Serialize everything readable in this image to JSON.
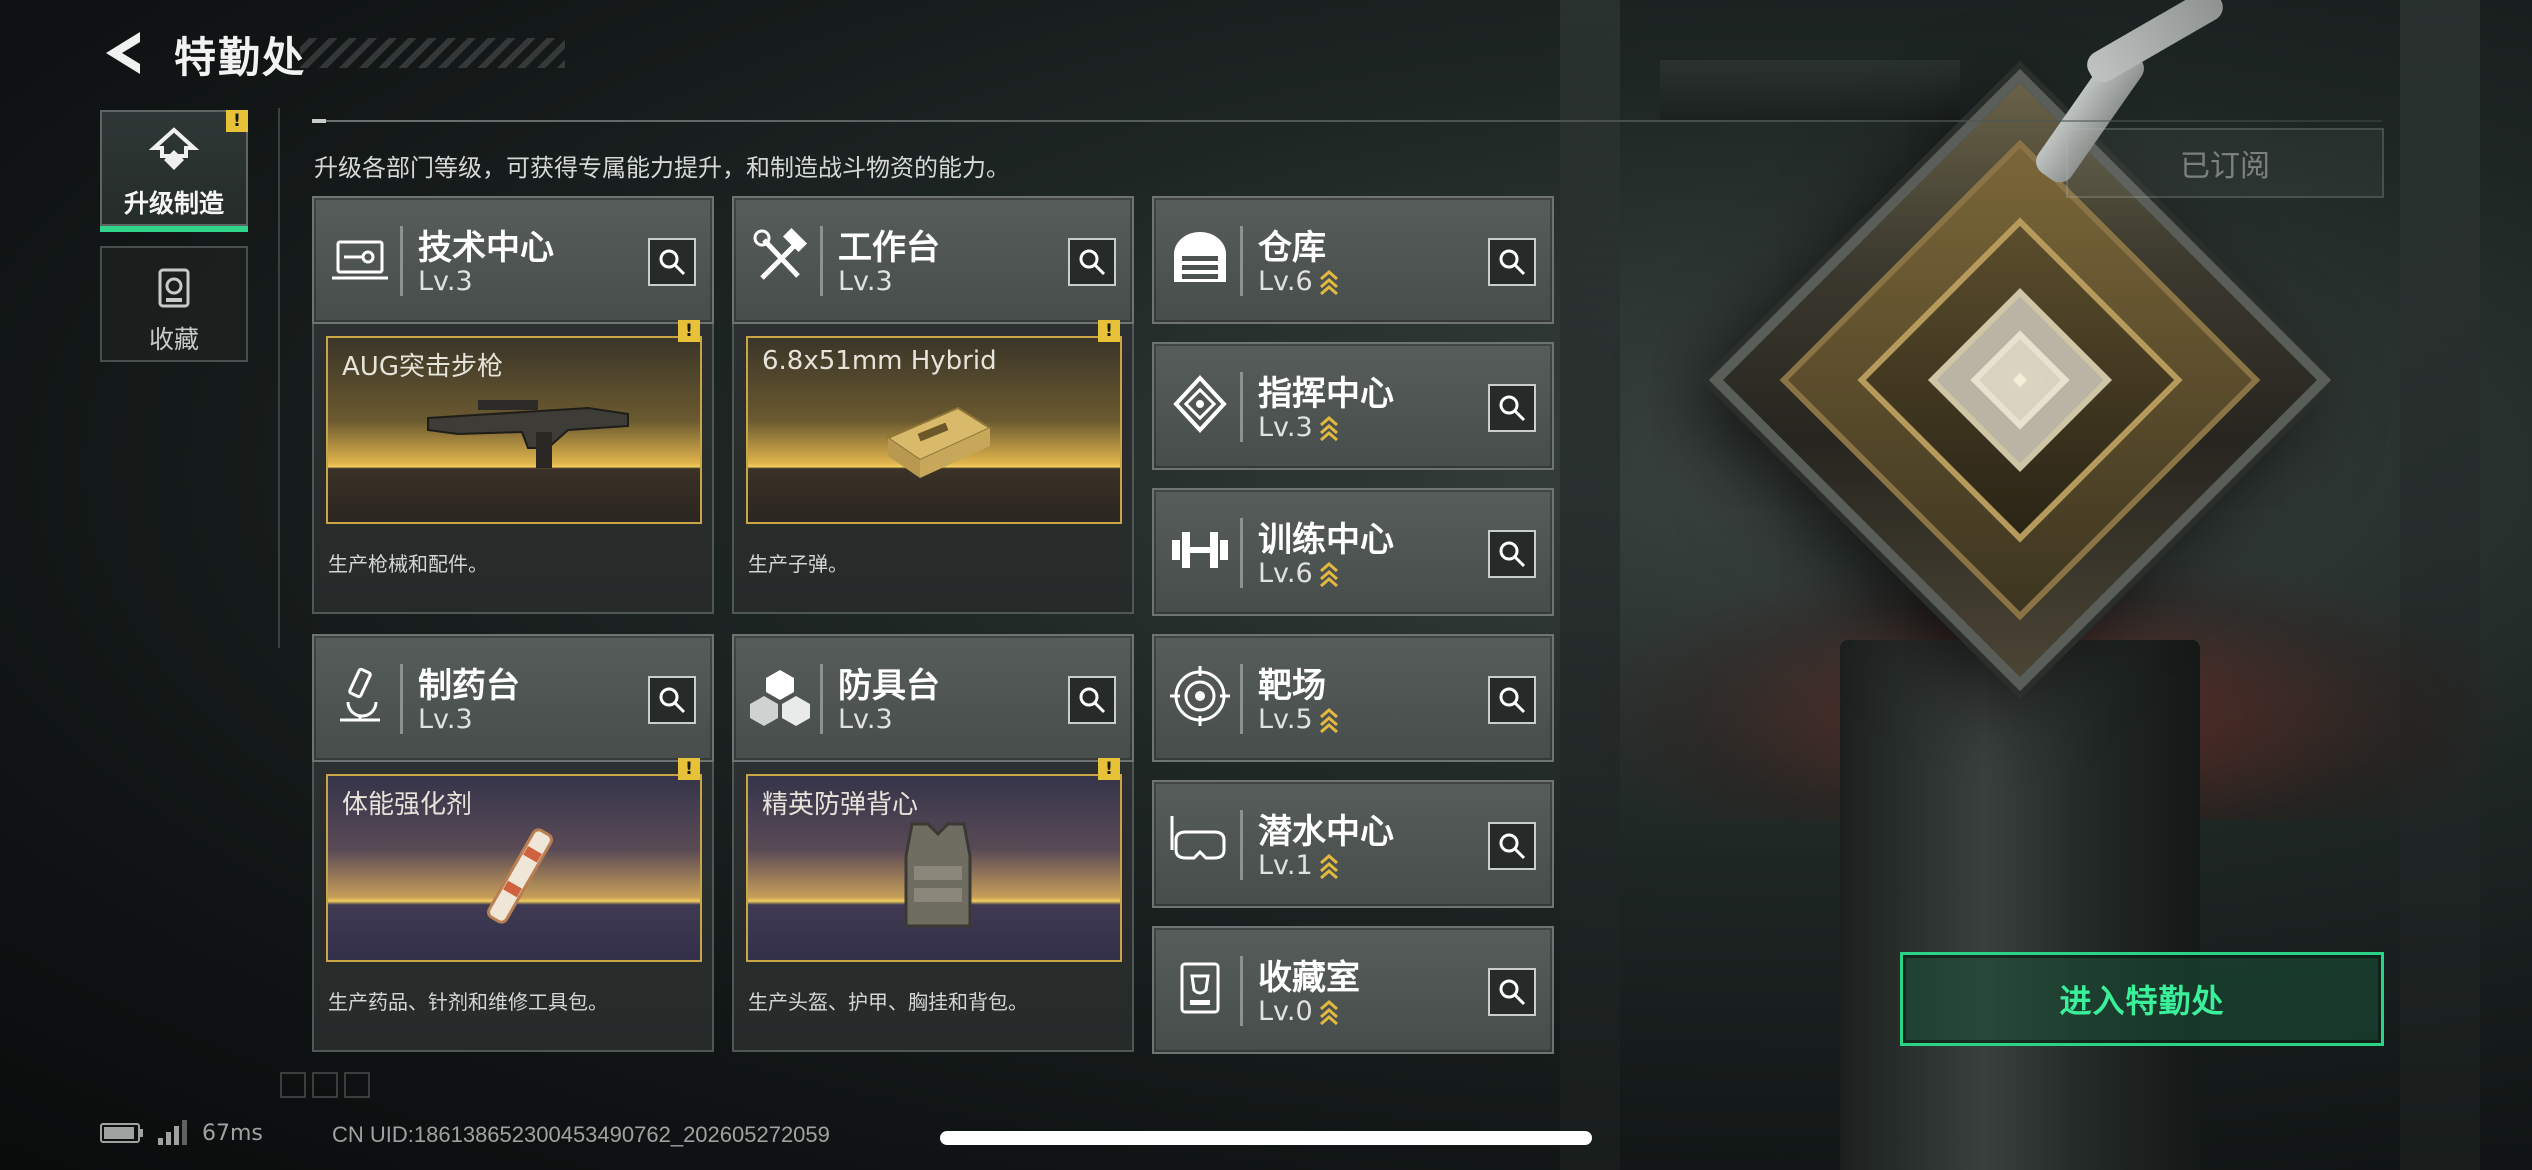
{
  "header": {
    "title": "特勤处"
  },
  "nav": [
    {
      "label": "升级制造",
      "icon": "upgrade-icon",
      "active": true
    },
    {
      "label": "收藏",
      "icon": "collection-icon",
      "active": false
    }
  ],
  "description": "升级各部门等级，可获得专属能力提升，和制造战斗物资的能力。",
  "subscribed_label": "已订阅",
  "enter_label": "进入特勤处",
  "departments": {
    "tech": {
      "name": "技术中心",
      "level": "Lv.3",
      "icon": "tech-center-icon"
    },
    "workbench": {
      "name": "工作台",
      "level": "Lv.3",
      "icon": "hammer-wrench-icon"
    },
    "pharmacy": {
      "name": "制药台",
      "level": "Lv.3",
      "icon": "microscope-icon"
    },
    "armor": {
      "name": "防具台",
      "level": "Lv.3",
      "icon": "cubes-icon"
    },
    "warehouse": {
      "name": "仓库",
      "level": "Lv.6",
      "icon": "warehouse-icon"
    },
    "command": {
      "name": "指挥中心",
      "level": "Lv.3",
      "icon": "chip-icon"
    },
    "training": {
      "name": "训练中心",
      "level": "Lv.6",
      "icon": "dumbbell-icon"
    },
    "range": {
      "name": "靶场",
      "level": "Lv.5",
      "icon": "target-icon"
    },
    "diving": {
      "name": "潜水中心",
      "level": "Lv.1",
      "icon": "diving-mask-icon"
    },
    "collection": {
      "name": "收藏室",
      "level": "Lv.0",
      "icon": "trophy-icon"
    }
  },
  "production": {
    "tech": {
      "item": "AUG突击步枪",
      "desc": "生产枪械和配件。"
    },
    "workbench": {
      "item": "6.8x51mm Hybrid",
      "desc": "生产子弹。"
    },
    "pharmacy": {
      "item": "体能强化剂",
      "desc": "生产药品、针剂和维修工具包。"
    },
    "armor": {
      "item": "精英防弹背心",
      "desc": "生产头盔、护甲、胸挂和背包。"
    }
  },
  "status": {
    "ping": "67ms",
    "uid": "CN UID:18613865230045349076​2_202605272059"
  },
  "colors": {
    "accent_green": "#2bd387",
    "alert_yellow": "#e7c137",
    "gold_frame": "#c9a545"
  }
}
